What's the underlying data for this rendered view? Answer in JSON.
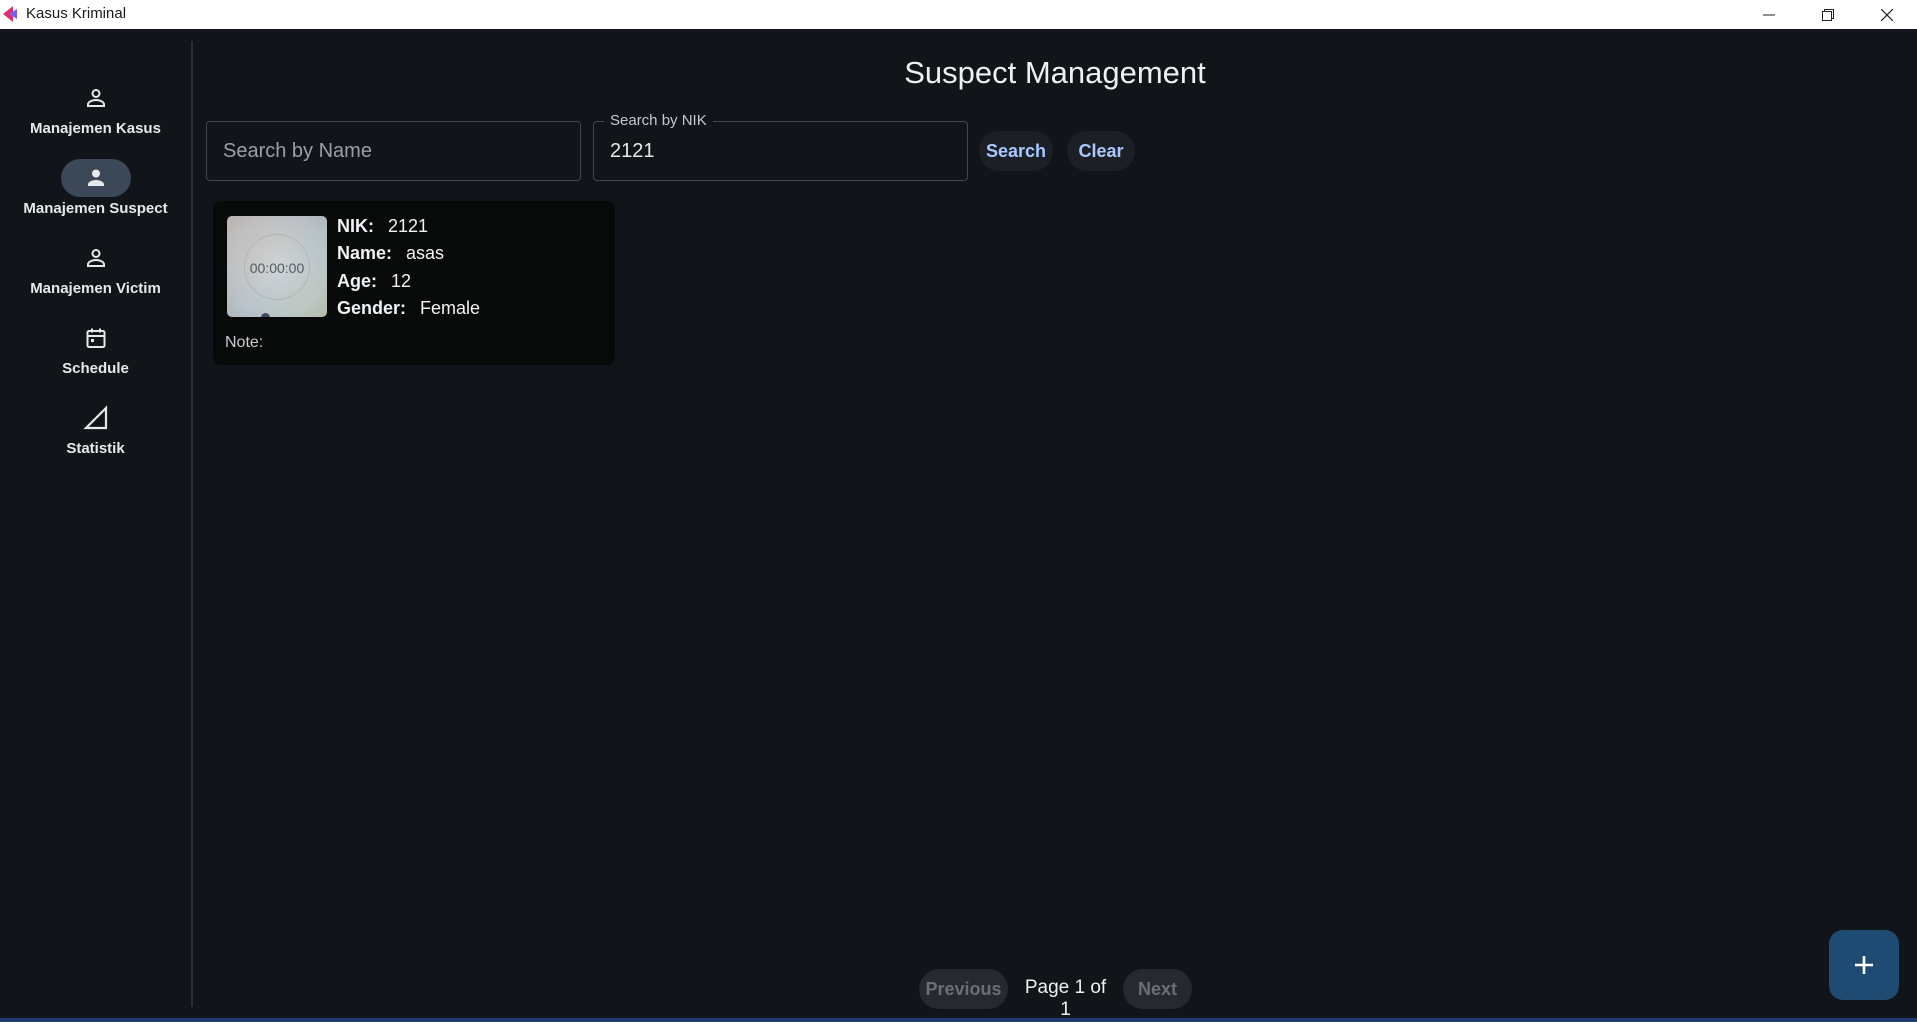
{
  "window": {
    "title": "Kasus Kriminal",
    "minimize_glyph": "—",
    "maximize_glyph": "❐",
    "close_glyph": "✕"
  },
  "sidebar": {
    "items": [
      {
        "label": "Manajemen Kasus",
        "icon": "person-icon",
        "active": false
      },
      {
        "label": "Manajemen Suspect",
        "icon": "person-icon",
        "active": true
      },
      {
        "label": "Manajemen Victim",
        "icon": "person-icon",
        "active": false
      },
      {
        "label": "Schedule",
        "icon": "calendar-icon",
        "active": false
      },
      {
        "label": "Statistik",
        "icon": "triangle-chart-icon",
        "active": false
      }
    ]
  },
  "header": {
    "title": "Suspect Management"
  },
  "search": {
    "name_placeholder": "Search by Name",
    "name_value": "",
    "nik_label": "Search by NIK",
    "nik_value": "2121",
    "search_label": "Search",
    "clear_label": "Clear"
  },
  "suspects": [
    {
      "thumbnail_time": "00:00:00",
      "nik_key": "NIK:",
      "nik": "2121",
      "name_key": "Name:",
      "name": "asas",
      "age_key": "Age:",
      "age": "12",
      "gender_key": "Gender:",
      "gender": "Female",
      "note_key": "Note:",
      "note": ""
    }
  ],
  "pagination": {
    "previous_label": "Previous",
    "page_text": "Page 1 of 1",
    "next_label": "Next"
  },
  "fab": {
    "label": "+"
  },
  "colors": {
    "background": "#111418",
    "active_nav": "#3c4858",
    "accent_text": "#a8c8ff",
    "fab": "#1f4b73"
  }
}
